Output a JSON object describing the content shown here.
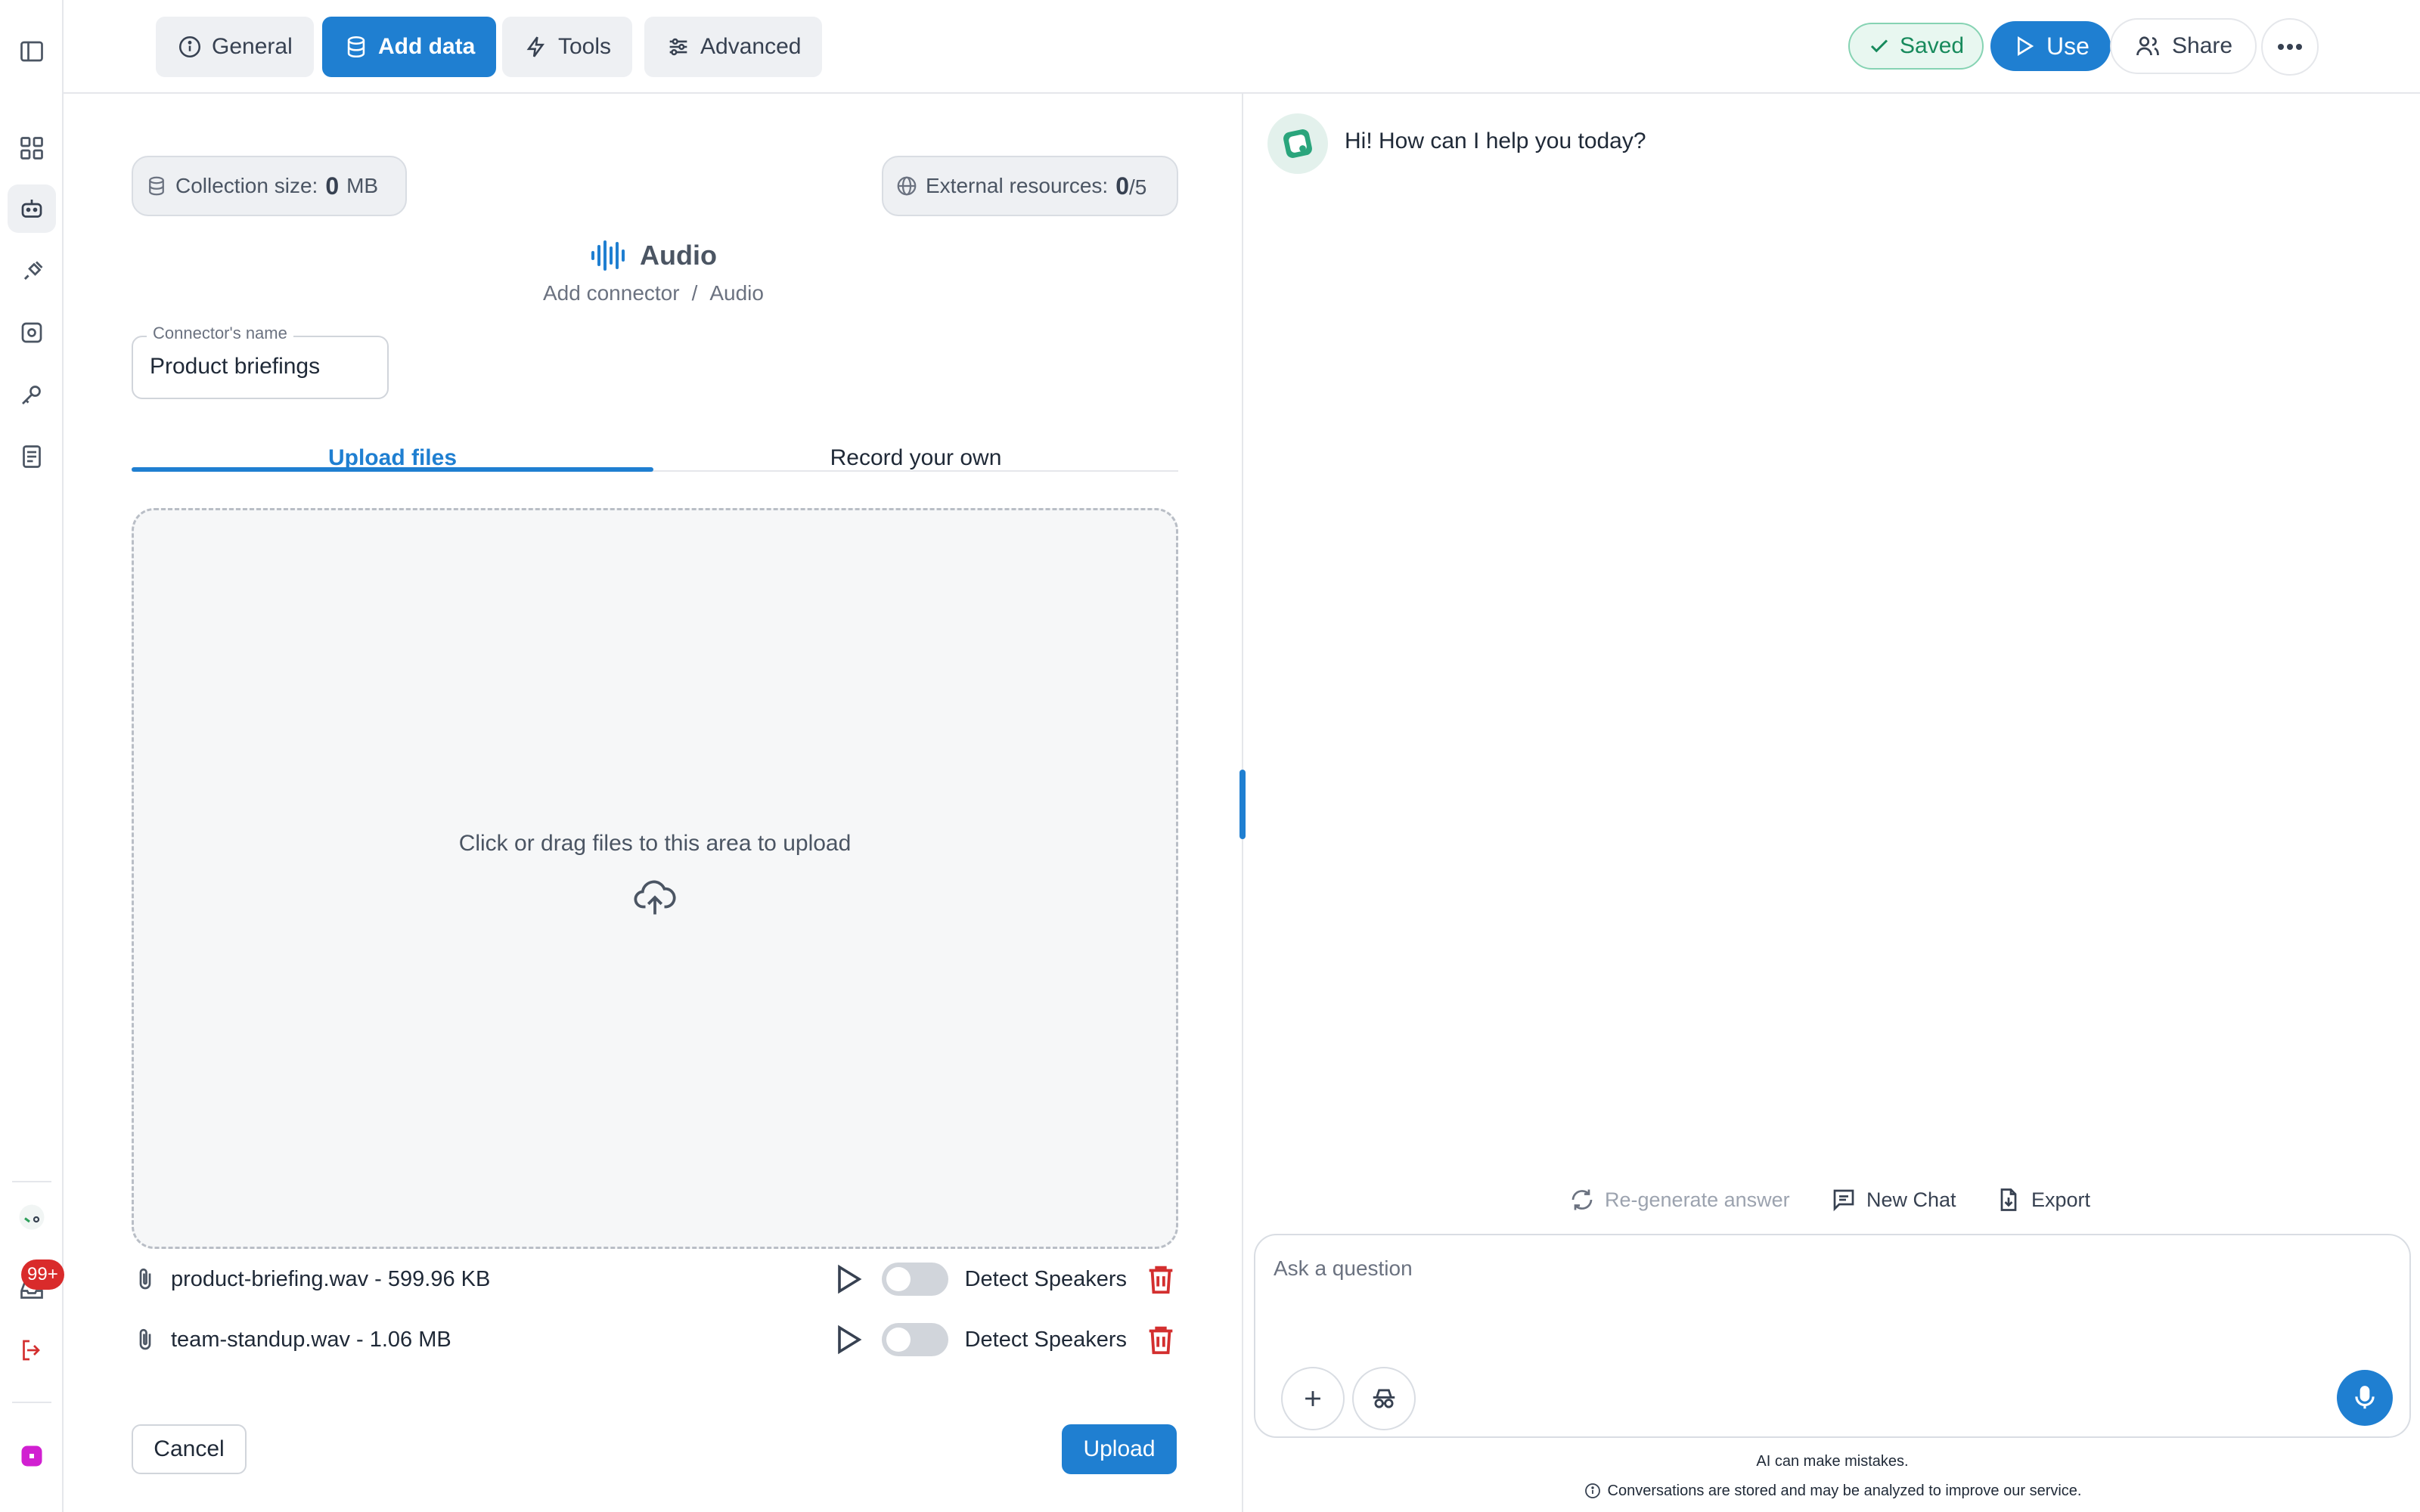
{
  "toolbar": {
    "tabs": [
      {
        "label": "General",
        "icon": "info-icon"
      },
      {
        "label": "Add data",
        "icon": "database-icon",
        "active": true
      },
      {
        "label": "Tools",
        "icon": "lightning-icon"
      },
      {
        "label": "Advanced",
        "icon": "sliders-icon"
      }
    ],
    "saved_label": "Saved",
    "use_label": "Use",
    "share_label": "Share"
  },
  "rail": {
    "notification_count": "99+"
  },
  "stats": {
    "collection_label": "Collection size:",
    "collection_value": "0",
    "collection_unit": "MB",
    "external_label": "External resources:",
    "external_value": "0",
    "external_total": "/5"
  },
  "connector": {
    "title": "Audio",
    "breadcrumb_root": "Add connector",
    "breadcrumb_sep": "/",
    "breadcrumb_current": "Audio",
    "name_label": "Connector's name",
    "name_value": "Product briefings"
  },
  "upload_tabs": {
    "upload_files": "Upload files",
    "record_own": "Record your own"
  },
  "dropzone": {
    "text": "Click or drag files to this area to upload"
  },
  "files": [
    {
      "name": "product-briefing.wav - 599.96 KB",
      "detect_label": "Detect Speakers",
      "detect_on": false
    },
    {
      "name": "team-standup.wav - 1.06 MB",
      "detect_label": "Detect Speakers",
      "detect_on": false
    }
  ],
  "actions": {
    "cancel": "Cancel",
    "upload": "Upload"
  },
  "chat": {
    "greeting": "Hi! How can I help you today?",
    "regenerate": "Re-generate answer",
    "new_chat": "New Chat",
    "export": "Export",
    "input_placeholder": "Ask a question",
    "disclaimer": "AI can make mistakes.",
    "privacy_note": "Conversations are stored and may be analyzed to improve our service."
  },
  "colors": {
    "accent": "#1f7fd1",
    "saved_green": "#178a5c",
    "danger": "#d32f2f"
  }
}
